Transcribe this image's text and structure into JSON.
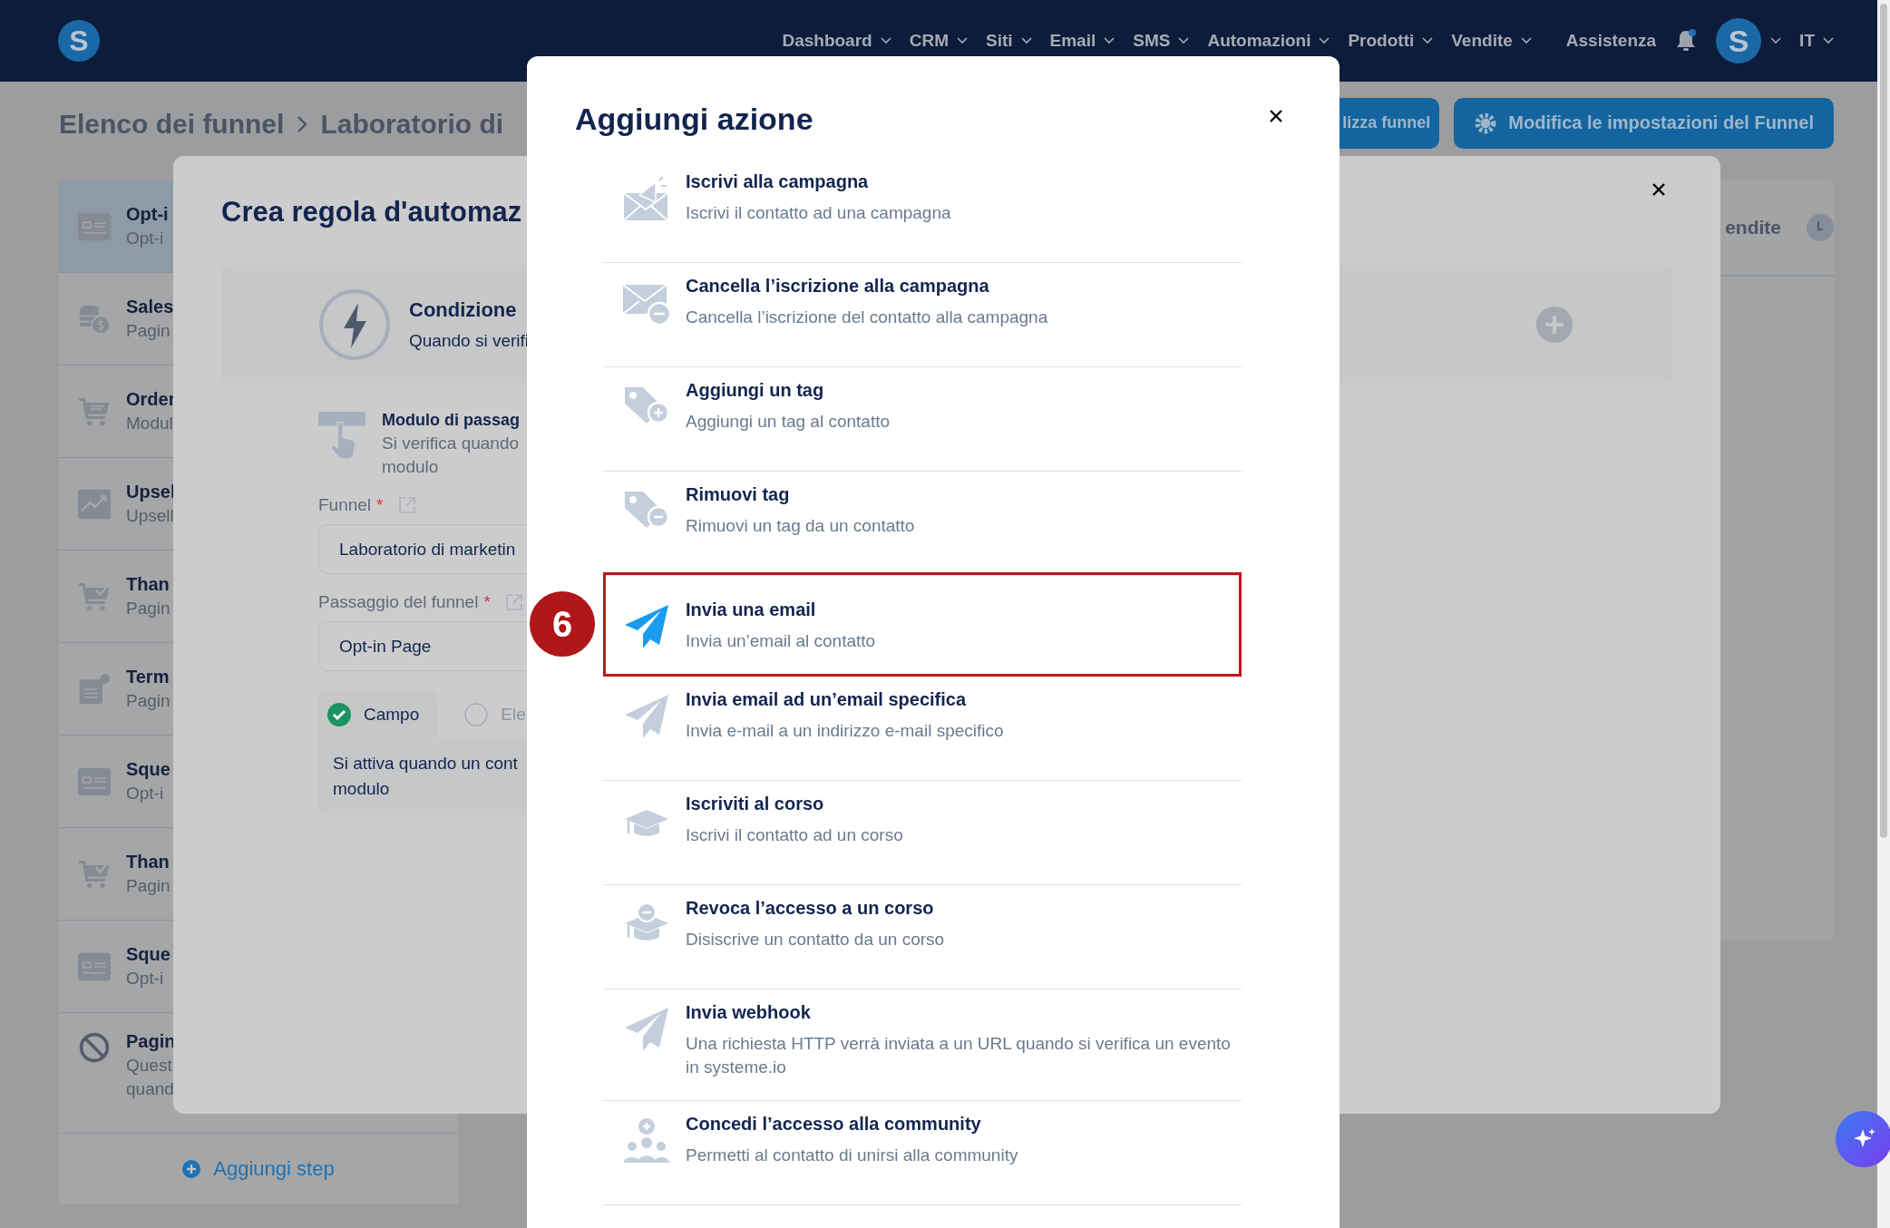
{
  "nav": {
    "logo": "S",
    "items": [
      {
        "label": "Dashboard"
      },
      {
        "label": "CRM"
      },
      {
        "label": "Siti"
      },
      {
        "label": "Email"
      },
      {
        "label": "SMS"
      },
      {
        "label": "Automazioni"
      },
      {
        "label": "Prodotti"
      },
      {
        "label": "Vendite"
      }
    ],
    "help": "Assistenza",
    "unread": true,
    "avatar": "S",
    "language": "IT"
  },
  "page": {
    "breadcrumb": [
      "Elenco dei funnel",
      "Laboratorio di"
    ],
    "buttons": [
      {
        "label": "lizza funnel",
        "kind": "plain"
      },
      {
        "label": "Modifica le impostazioni del Funnel",
        "kind": "settings"
      }
    ],
    "steps": [
      {
        "title": "Opt-i",
        "subtitle": "Opt-i",
        "kind": "form",
        "selected": true
      },
      {
        "title": "Sales",
        "subtitle": "Pagin",
        "kind": "coins",
        "selected": false
      },
      {
        "title": "Order",
        "subtitle": "Modul",
        "kind": "cart",
        "selected": false
      },
      {
        "title": "Upsel",
        "subtitle": "Upsell",
        "kind": "chart",
        "selected": false
      },
      {
        "title": "Than",
        "subtitle": "Pagin",
        "kind": "cart-check",
        "selected": false
      },
      {
        "title": "Term",
        "subtitle": "Pagin",
        "kind": "doc",
        "selected": false
      },
      {
        "title": "Sque",
        "subtitle": "Opt-i",
        "kind": "form",
        "selected": false
      },
      {
        "title": "Than",
        "subtitle": "Pagin",
        "kind": "cart-check",
        "selected": false
      },
      {
        "title": "Sque",
        "subtitle": "Opt-i",
        "kind": "form",
        "selected": false
      },
      {
        "title": "Pagin",
        "subtitle": "Quest",
        "subtitle_2": "quand",
        "kind": "blocked",
        "selected": false
      }
    ],
    "add_step": "Aggiungi step",
    "panel_tab": "endite"
  },
  "rule_modal": {
    "title": "Crea regola d'automaz",
    "condition_title": "Condizione",
    "condition_text": "Quando si verifi",
    "trigger_title": "Modulo di passag",
    "trigger_text": "Si verifica quando",
    "trigger_text_2": "modulo",
    "funnel_label": "Funnel",
    "funnel_required": "*",
    "funnel_value": "Laboratorio di marketin",
    "step_label": "Passaggio del funnel",
    "step_required": "*",
    "step_value": "Opt-in Page",
    "modes": [
      {
        "label": "Campo",
        "selected": true
      },
      {
        "label": "Ele",
        "selected": false
      }
    ],
    "mode_text": "Si attiva quando un cont",
    "mode_text_2": "modulo"
  },
  "action_modal": {
    "title": "Aggiungi azione",
    "step_badge": "6",
    "actions": [
      {
        "title": "Iscrivi alla campagna",
        "description": "Iscrivi il contatto ad una campagna",
        "kind": "mail-megaphone",
        "selected": false
      },
      {
        "title": "Cancella l’iscrizione alla campagna",
        "description": "Cancella l’iscrizione del contatto alla campagna",
        "kind": "mail-minus",
        "selected": false
      },
      {
        "title": "Aggiungi un tag",
        "description": "Aggiungi un tag al contatto",
        "kind": "tag-plus",
        "selected": false
      },
      {
        "title": "Rimuovi tag",
        "description": "Rimuovi un tag da un contatto",
        "kind": "tag-minus",
        "selected": false
      },
      {
        "title": "Invia una email",
        "description": "Invia un’email al contatto",
        "kind": "plane",
        "selected": true
      },
      {
        "title": "Invia email ad un’email specifica",
        "description": "Invia e-mail a un indirizzo e-mail specifico",
        "kind": "plane",
        "selected": false
      },
      {
        "title": "Iscriviti al corso",
        "description": "Iscrivi il contatto ad un corso",
        "kind": "cap",
        "selected": false
      },
      {
        "title": "Revoca l’accesso a un corso",
        "description": "Disiscrive un contatto da un corso",
        "kind": "cap-minus",
        "selected": false
      },
      {
        "title": "Invia webhook",
        "description": "Una richiesta HTTP verrà inviata a un URL quando si verifica un evento in systeme.io",
        "kind": "plane",
        "selected": false
      },
      {
        "title": "Concedi l’accesso alla community",
        "description": "Permetti al contatto di unirsi alla community",
        "kind": "people-plus",
        "selected": false
      }
    ]
  }
}
